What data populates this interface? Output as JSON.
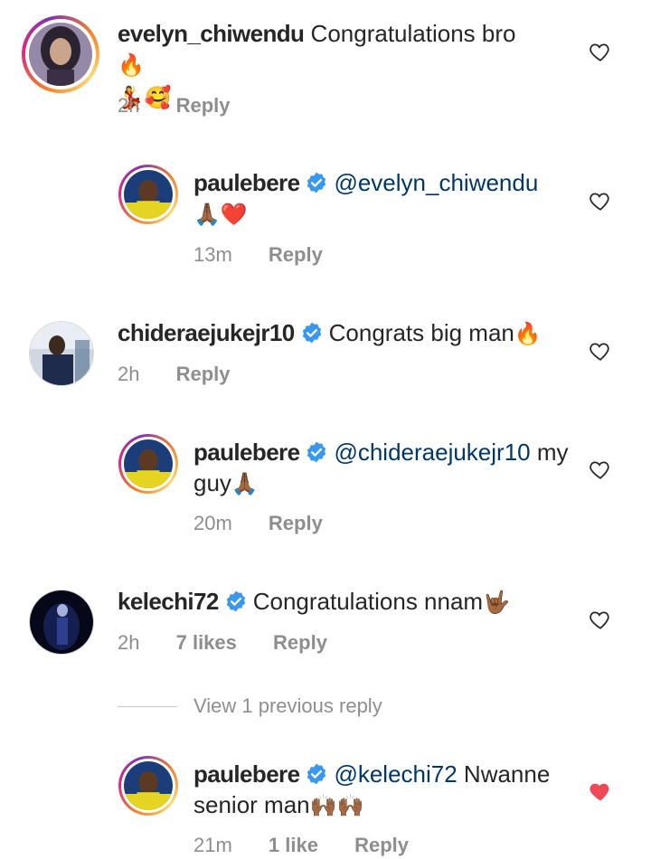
{
  "comments": [
    {
      "username": "evelyn_chiwendu",
      "text": "Congratulations bro",
      "emoji_line1": "🔥",
      "emoji_line2": "💃🥰",
      "time": "2h",
      "reply_label": "Reply",
      "liked": false
    },
    {
      "username": "paulebere",
      "mention": "@evelyn_chiwendu",
      "text": "",
      "emoji_line2": "🙏🏾❤️",
      "time": "13m",
      "reply_label": "Reply",
      "liked": false
    },
    {
      "username": "chideraejukejr10",
      "text": "Congrats big man",
      "emoji_line1": "🔥",
      "time": "2h",
      "reply_label": "Reply",
      "liked": false
    },
    {
      "username": "paulebere",
      "mention": "@chideraejukejr10",
      "text": "my",
      "line2": "guy",
      "emoji_line2": "🙏🏾",
      "time": "20m",
      "reply_label": "Reply",
      "liked": false
    },
    {
      "username": "kelechi72",
      "text": "Congratulations nnam",
      "emoji_line1": "🤟🏾",
      "time": "2h",
      "likes": "7 likes",
      "reply_label": "Reply",
      "liked": false
    },
    {
      "username": "paulebere",
      "mention": "@kelechi72",
      "text": "Nwanne",
      "line2": "senior man",
      "emoji_line2": "🙌🏾🙌🏾",
      "time": "21m",
      "likes": "1 like",
      "reply_label": "Reply",
      "liked": true
    }
  ],
  "view_replies_label": "View 1 previous reply",
  "colors": {
    "verified_blue": "#3897f0",
    "mention": "#00376b",
    "meta_gray": "#8e8e8e",
    "heart_red": "#ed4956"
  }
}
